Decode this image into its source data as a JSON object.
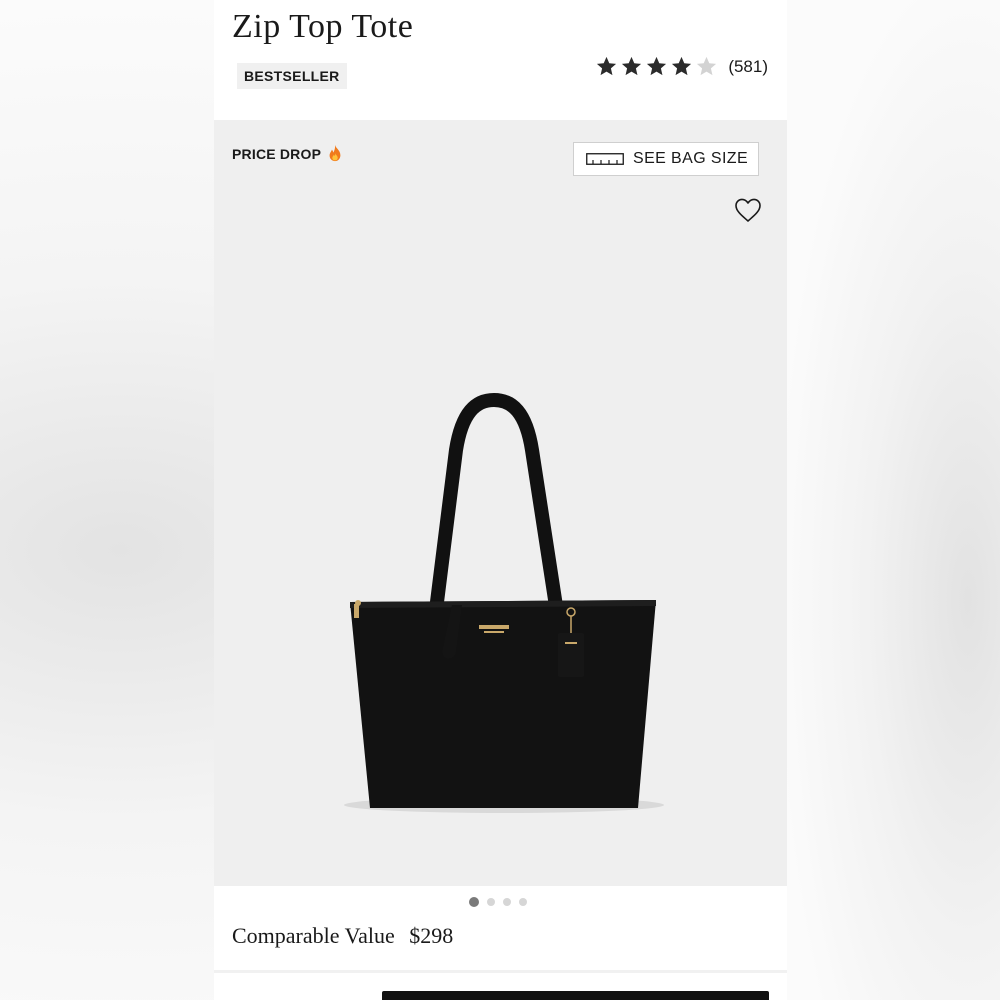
{
  "product": {
    "title": "Zip Top Tote",
    "badge": "BESTSELLER",
    "rating": {
      "stars_filled": 4,
      "stars_total": 5,
      "count_label": "(581)"
    }
  },
  "gallery": {
    "promo_label": "PRICE DROP",
    "promo_icon": "fire-icon",
    "size_button_label": "SEE BAG SIZE",
    "size_button_icon": "ruler-icon",
    "wishlist_icon": "heart-icon",
    "slide_count": 4,
    "active_slide": 1
  },
  "pricing": {
    "label": "Comparable Value",
    "price": "$298"
  },
  "colors": {
    "star_filled": "#2b2b2b",
    "star_empty": "#cfcfcf",
    "bag": "#111111",
    "hardware": "#c9a86a"
  }
}
